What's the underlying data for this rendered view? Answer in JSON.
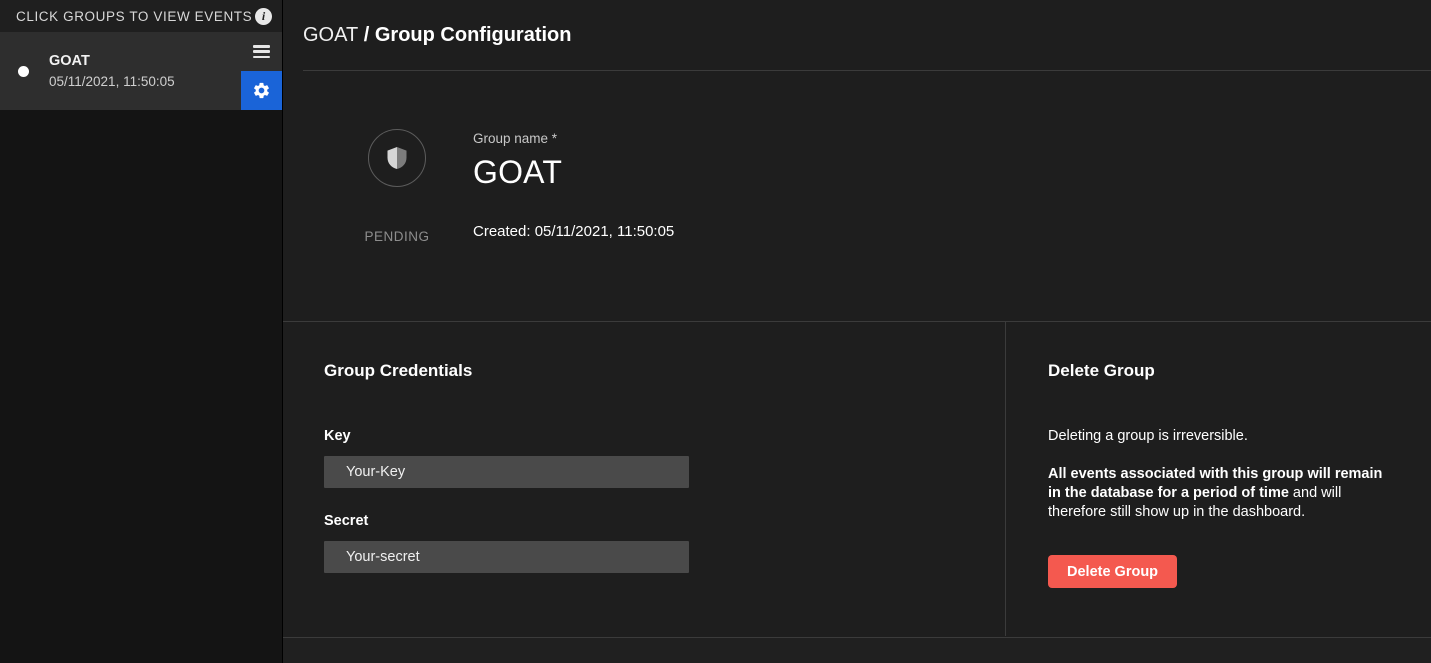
{
  "sidebar": {
    "header_title": "CLICK GROUPS TO VIEW EVENTS",
    "info_icon": "info-icon",
    "info_glyph": "i",
    "groups": [
      {
        "name": "GOAT",
        "timestamp": "05/11/2021, 11:50:05",
        "selected": true,
        "menu_icon": "hamburger-icon",
        "settings_icon": "gear-icon"
      }
    ]
  },
  "header": {
    "breadcrumb_root": "GOAT",
    "breadcrumb_separator": " / ",
    "breadcrumb_current": "Group Configuration"
  },
  "summary": {
    "avatar_icon": "shield-icon",
    "status": "PENDING",
    "group_name_label": "Group name *",
    "group_name_value": "GOAT",
    "created_text": "Created: 05/11/2021, 11:50:05"
  },
  "credentials": {
    "title": "Group Credentials",
    "key_label": "Key",
    "key_value": "Your-Key",
    "key_placeholder": "Your-Key",
    "secret_label": "Secret",
    "secret_value": "Your-secret",
    "secret_placeholder": "Your-secret"
  },
  "delete": {
    "title": "Delete Group",
    "note": "Deleting a group is irreversible.",
    "warning_bold": "All events associated with this group will remain in the database for a period of time",
    "warning_rest": " and will therefore still show up in the dashboard.",
    "button_label": "Delete Group"
  },
  "colors": {
    "accent_blue": "#1a64d8",
    "danger_red": "#f4594f",
    "page_bg": "#1e1e1e",
    "sidebar_bg": "#141414",
    "input_bg": "#4a4a4a"
  }
}
